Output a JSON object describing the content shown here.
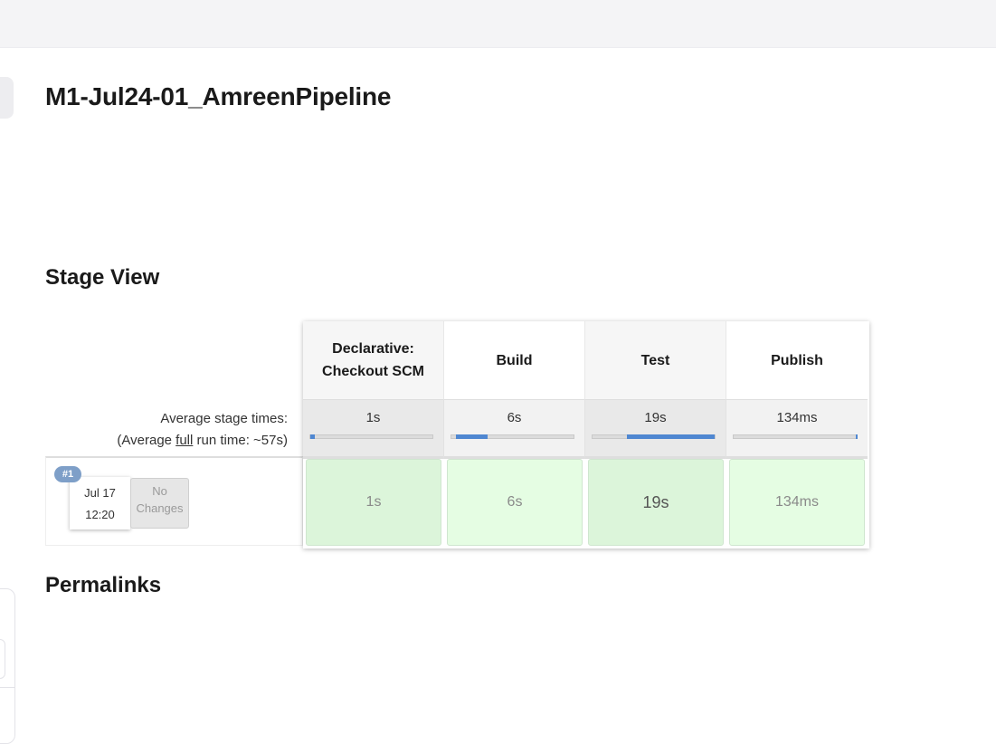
{
  "page": {
    "title": "M1-Jul24-01_AmreenPipeline"
  },
  "sections": {
    "stage_view": "Stage View",
    "permalinks": "Permalinks"
  },
  "summary": {
    "avg_stage_times": "Average stage times:",
    "avg_full_prefix": "(Average ",
    "avg_full_link": "full",
    "avg_full_suffix": " run time: ~57s)"
  },
  "stages": [
    {
      "name_line1": "Declarative:",
      "name_line2": "Checkout SCM",
      "avg": "1s",
      "bar_start": 0.0,
      "bar_fraction": 0.04,
      "run": "1s"
    },
    {
      "name_line1": "Build",
      "name_line2": "",
      "avg": "6s",
      "bar_start": 0.04,
      "bar_fraction": 0.26,
      "run": "6s"
    },
    {
      "name_line1": "Test",
      "name_line2": "",
      "avg": "19s",
      "bar_start": 0.28,
      "bar_fraction": 0.72,
      "run": "19s"
    },
    {
      "name_line1": "Publish",
      "name_line2": "",
      "avg": "134ms",
      "bar_start": 0.99,
      "bar_fraction": 0.01,
      "run": "134ms"
    }
  ],
  "build": {
    "number": "#1",
    "date": "Jul 17",
    "time": "12:20",
    "changes_line1": "No",
    "changes_line2": "Changes"
  },
  "colors": {
    "success_cell": "#e5fde3",
    "success_cell_shaded": "#dcf5da",
    "progress_bar": "#4f87d1",
    "badge": "#7e9fc8"
  }
}
